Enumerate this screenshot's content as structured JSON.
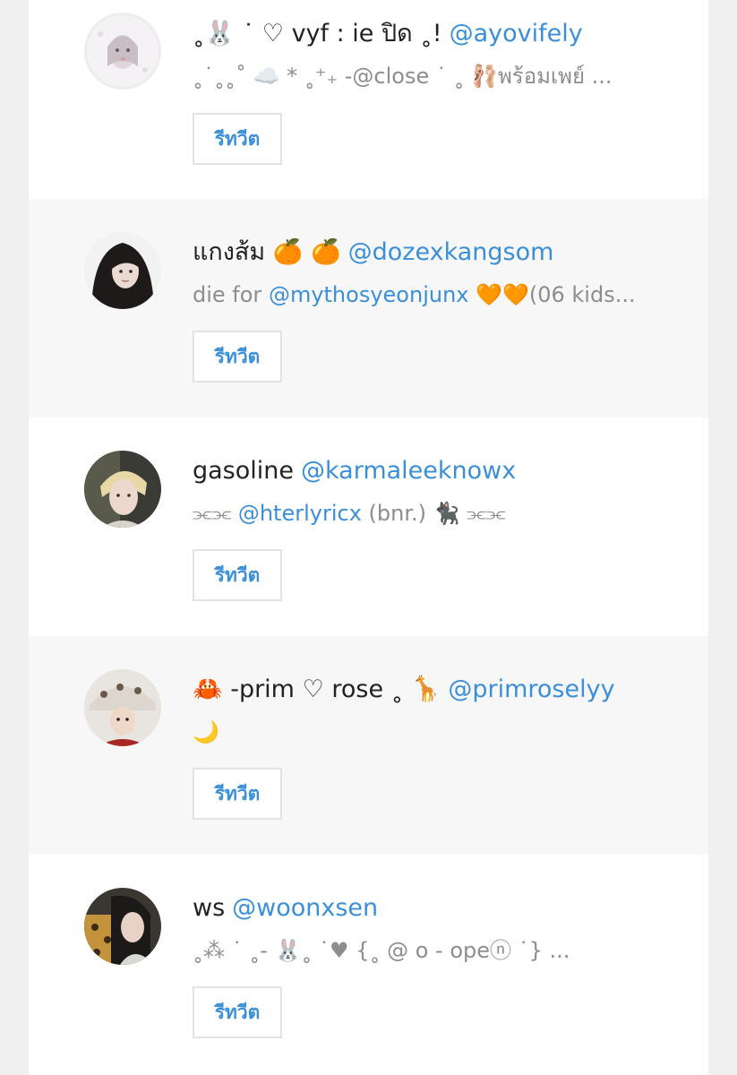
{
  "users": [
    {
      "display_name": "˳🐰 ˙ ♡ vyf : ie ปิด ˳!",
      "handle": "@ayovifely",
      "bio_parts": [
        {
          "text": "˳˙˳˳˚ ☁️ * ˳⁺₊ -@close ˙ ˳ 🩰พร้อมเพย์ ...",
          "mention": false
        }
      ],
      "button_label": "รีทวีต"
    },
    {
      "display_name": "แกงส้ม 🍊 🍊",
      "handle": "@dozexkangsom",
      "bio_parts": [
        {
          "text": "die for ",
          "mention": false
        },
        {
          "text": "@mythosyeonjunx",
          "mention": true
        },
        {
          "text": " 🧡🧡(06 kids...",
          "mention": false
        }
      ],
      "button_label": "รีทวีต"
    },
    {
      "display_name": "gasoline",
      "handle": "@karmaleeknowx",
      "bio_parts": [
        {
          "text": "⫘⫘ ",
          "mention": false
        },
        {
          "text": "@hterlyricx",
          "mention": true
        },
        {
          "text": " (bnr.) 🐈‍⬛ ⫘⫘",
          "mention": false
        }
      ],
      "button_label": "รีทวีต"
    },
    {
      "display_name": "🦀 -prim ♡ rose ˳ 🦒",
      "handle": "@primroselyy",
      "bio_parts": [
        {
          "text": "🌙",
          "mention": false
        }
      ],
      "button_label": "รีทวีต"
    },
    {
      "display_name": "ws",
      "handle": "@woonxsen",
      "bio_parts": [
        {
          "text": "˳⁂ ˙ ˳- 🐰˳ ˙♥ {˳ @ o - opeⓝ ˙} ...",
          "mention": false
        }
      ],
      "button_label": "รีทวีต"
    }
  ],
  "colors": {
    "link": "#3b8fd8",
    "name": "#222222",
    "bio": "#8d8d8d",
    "alt_row": "#f7f7f7"
  }
}
